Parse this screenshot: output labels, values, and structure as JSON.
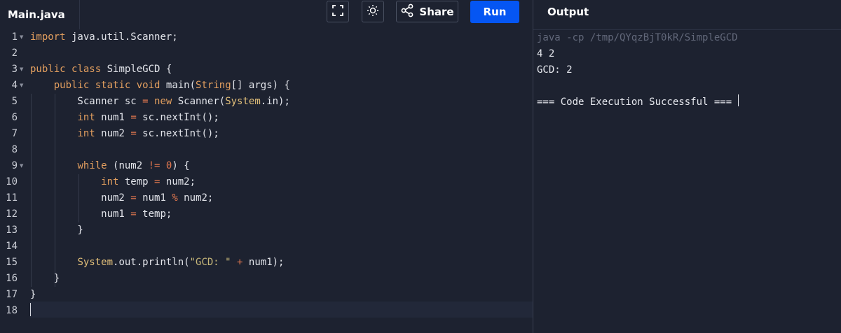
{
  "editor": {
    "tab_label": "Main.java",
    "lines": [
      "import java.util.Scanner;",
      "",
      "public class SimpleGCD {",
      "    public static void main(String[] args) {",
      "        Scanner sc = new Scanner(System.in);",
      "        int num1 = sc.nextInt();",
      "        int num2 = sc.nextInt();",
      "",
      "        while (num2 != 0) {",
      "            int temp = num2;",
      "            num2 = num1 % num2;",
      "            num1 = temp;",
      "        }",
      "",
      "        System.out.println(\"GCD: \" + num1);",
      "    }",
      "}",
      ""
    ],
    "line_numbers": [
      "1",
      "2",
      "3",
      "4",
      "5",
      "6",
      "7",
      "8",
      "9",
      "10",
      "11",
      "12",
      "13",
      "14",
      "15",
      "16",
      "17",
      "18"
    ],
    "foldable_lines": [
      1,
      3,
      4,
      9
    ]
  },
  "toolbar": {
    "fullscreen_icon": "fullscreen-icon",
    "theme_icon": "sun-icon",
    "share_icon": "share-icon",
    "share_label": "Share",
    "run_label": "Run"
  },
  "output": {
    "title": "Output",
    "command": "java -cp /tmp/QYqzBjT0kR/SimpleGCD",
    "input_echo": "4 2",
    "result": "GCD: 2",
    "blank": "",
    "status": "=== Code Execution Successful ==="
  },
  "colors": {
    "background": "#1d2230",
    "run_button": "#0556f3",
    "keyword": "#e39f5f",
    "number": "#e3784f",
    "string": "#c8b87a"
  }
}
